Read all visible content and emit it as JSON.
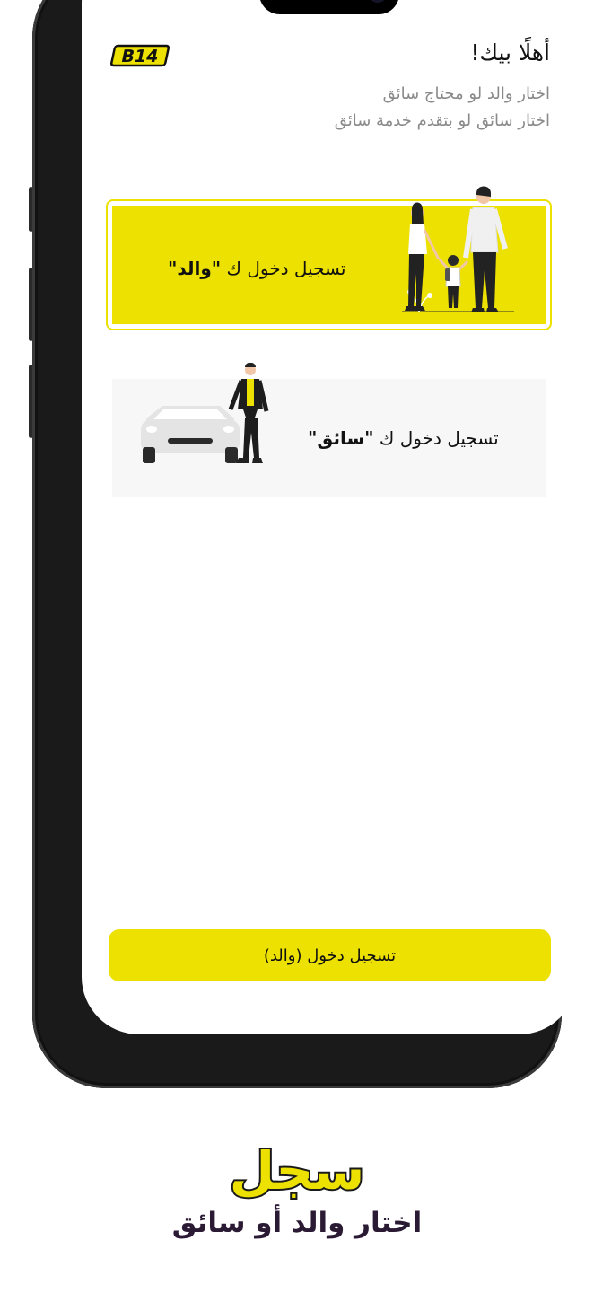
{
  "app": {
    "logo_text": "B14",
    "accent_color": "#ece100"
  },
  "header": {
    "greeting": "أهلًا بيك!",
    "line1": "اختار والد لو محتاج سائق",
    "line2": "اختار سائق لو بتقدم خدمة سائق"
  },
  "cards": {
    "parent": {
      "prefix": "تسجيل دخول ك ",
      "role": "\"والد\"",
      "illustration": "family-illustration"
    },
    "driver": {
      "prefix": "تسجيل دخول ك ",
      "role": "\"سائق\"",
      "illustration": "driver-car-illustration"
    }
  },
  "footer": {
    "button_label": "تسجيل دخول (والد)"
  },
  "promo": {
    "title": "سجل",
    "subtitle": "اختار والد أو سائق"
  }
}
